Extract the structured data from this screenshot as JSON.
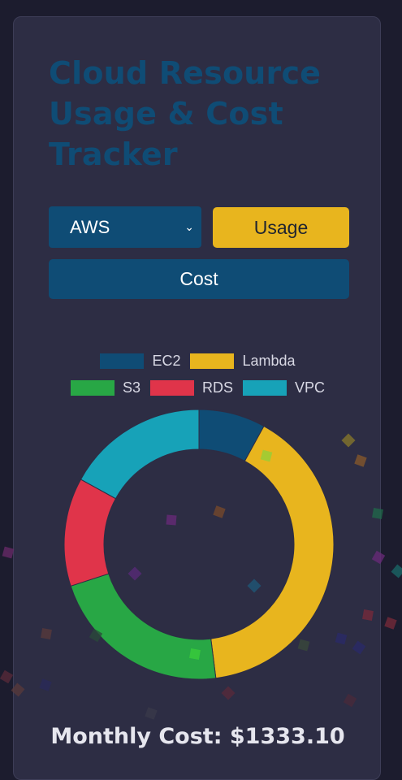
{
  "app": {
    "title": "Cloud Resource Usage & Cost Tracker"
  },
  "controls": {
    "provider_selected": "AWS",
    "usage_label": "Usage",
    "cost_label": "Cost"
  },
  "colors": {
    "primary": "#0f4c75",
    "accent": "#e8b51e",
    "card_bg": "#2d2d44",
    "page_bg": "#1c1c2e"
  },
  "chart_data": {
    "type": "doughnut",
    "categories": [
      "EC2",
      "Lambda",
      "S3",
      "RDS",
      "VPC"
    ],
    "values": [
      8,
      40,
      22,
      13,
      17
    ],
    "colors": [
      "#0f4c75",
      "#e8b51e",
      "#28a745",
      "#e0344a",
      "#17a2b8"
    ],
    "legend_position": "top"
  },
  "summary": {
    "monthly_cost_text": "Monthly Cost: $1333.10"
  }
}
